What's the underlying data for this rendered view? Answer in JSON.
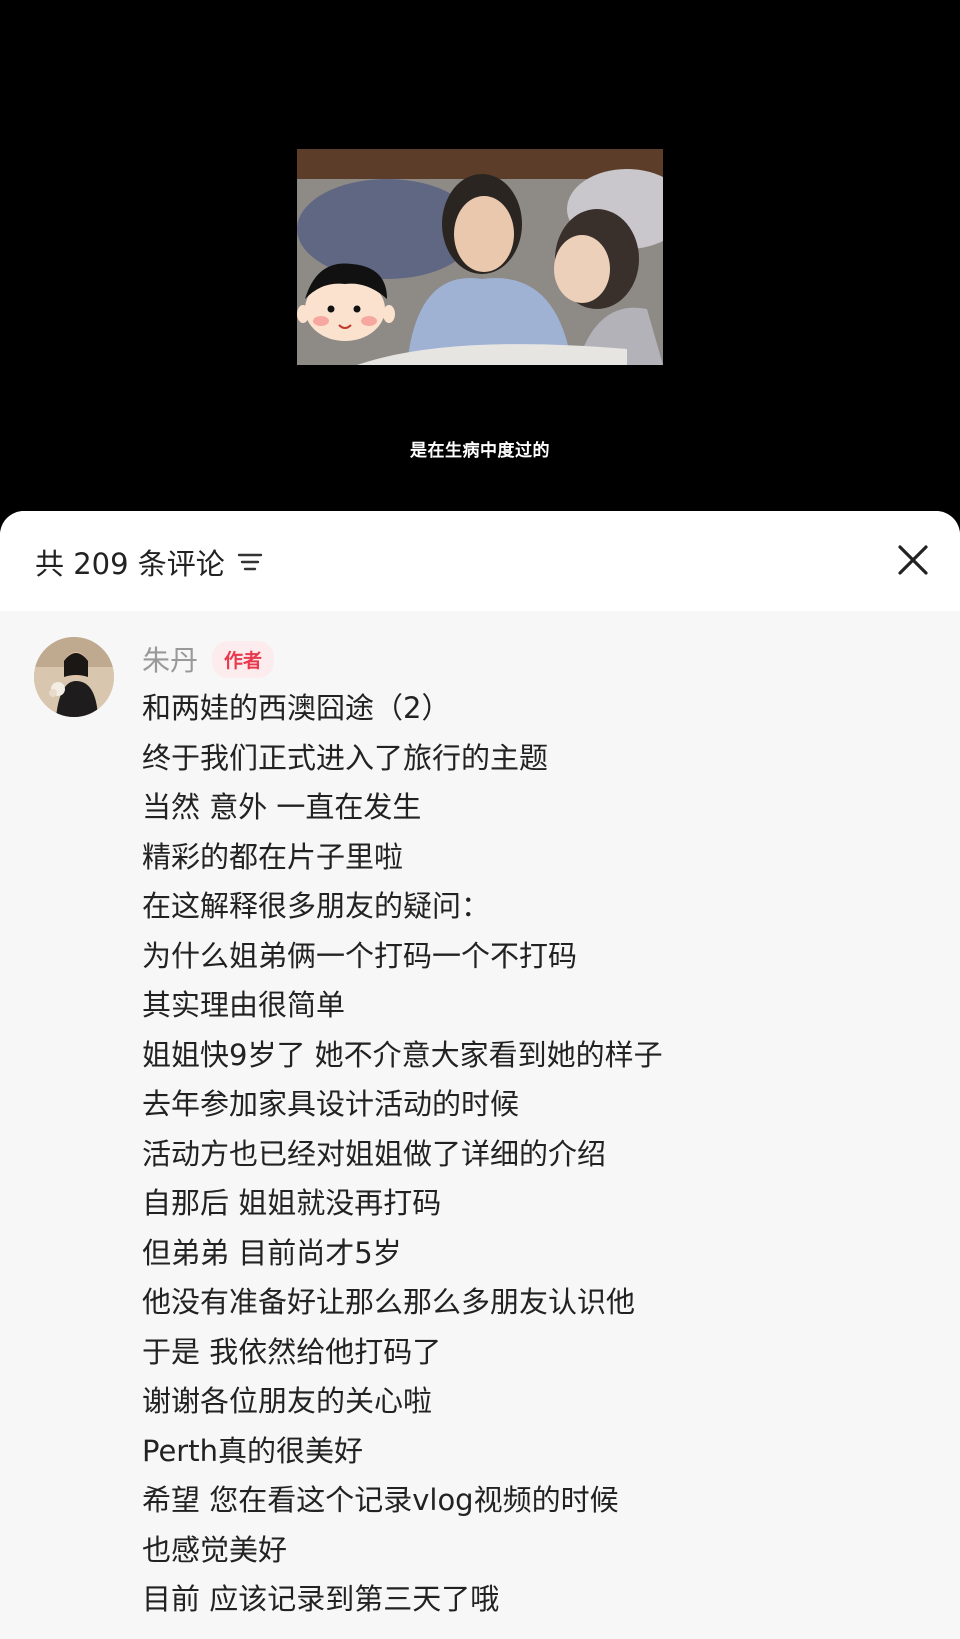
{
  "video": {
    "subtitle": "是在生病中度过的"
  },
  "comments_panel": {
    "count_label": "共 209 条评论",
    "icons": {
      "sort": "sort-lines-icon",
      "close": "close-icon"
    }
  },
  "comment": {
    "author": "朱丹",
    "badge": "作者",
    "lines": [
      "和两娃的西澳囧途（2）",
      "终于我们正式进入了旅行的主题",
      "当然 意外 一直在发生",
      "精彩的都在片子里啦",
      "在这解释很多朋友的疑问：",
      "为什么姐弟俩一个打码一个不打码",
      "其实理由很简单",
      "姐姐快9岁了 她不介意大家看到她的样子",
      "去年参加家具设计活动的时候",
      "活动方也已经对姐姐做了详细的介绍",
      "自那后 姐姐就没再打码",
      "但弟弟 目前尚才5岁",
      "他没有准备好让那么那么多朋友认识他",
      "于是 我依然给他打码了",
      "谢谢各位朋友的关心啦",
      "Perth真的很美好",
      "希望 您在看这个记录vlog视频的时候",
      "也感觉美好",
      "目前 应该记录到第三天了哦"
    ]
  },
  "colors": {
    "badge_text": "#e8394e",
    "badge_bg": "#fdecee",
    "author_name": "#999999",
    "sheet_bg": "#f7f7f7"
  }
}
